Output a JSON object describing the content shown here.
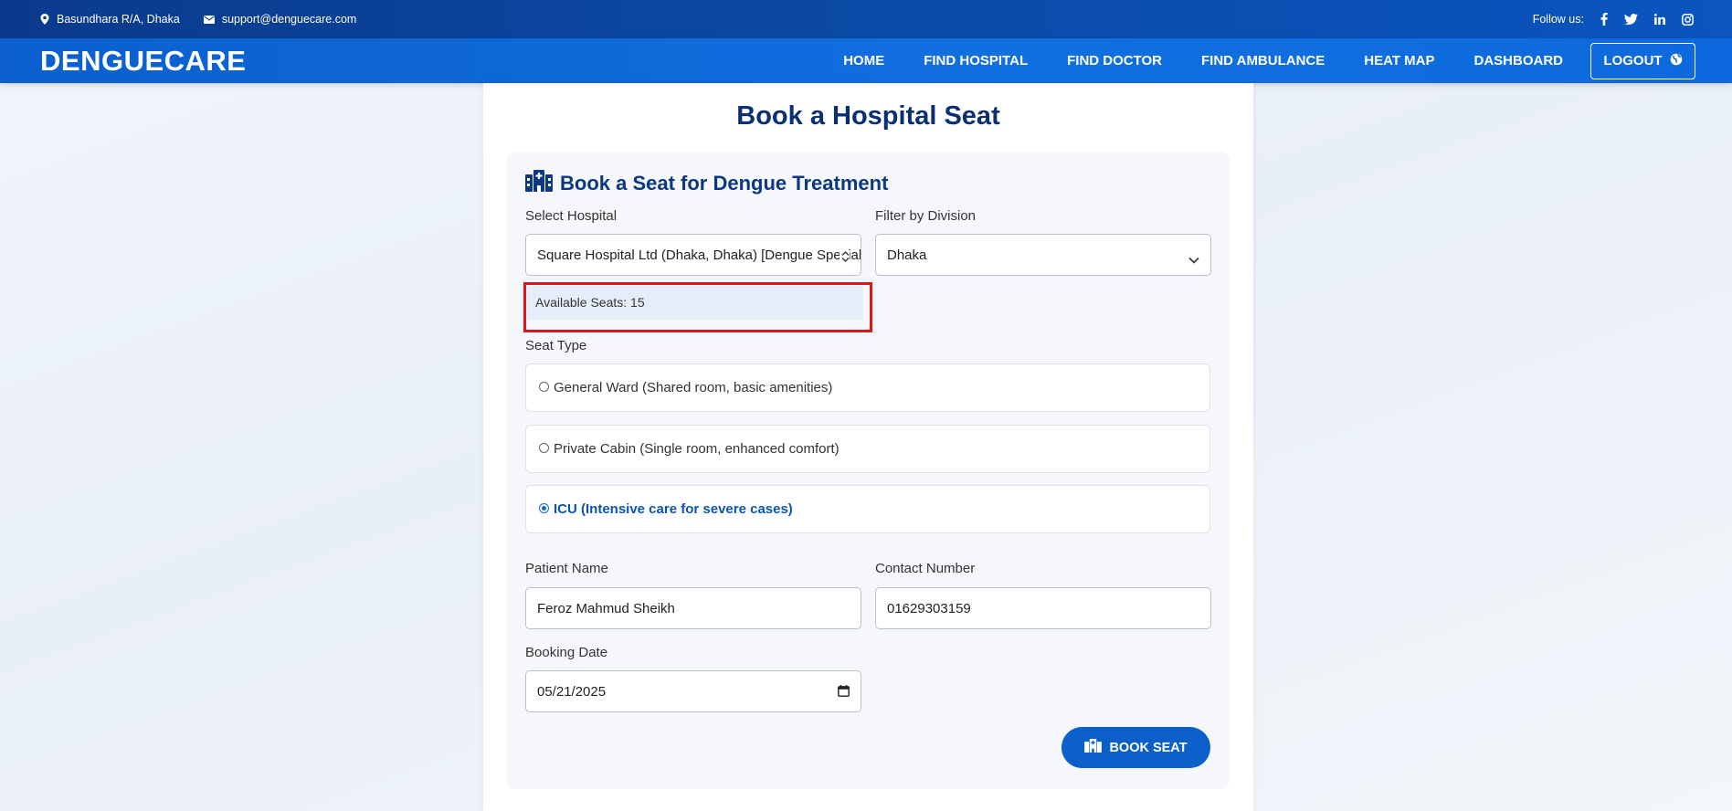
{
  "topbar": {
    "location": "Basundhara R/A, Dhaka",
    "email": "support@denguecare.com",
    "follow_label": "Follow us:",
    "social_icons": [
      "facebook-icon",
      "twitter-icon",
      "linkedin-icon",
      "instagram-icon"
    ]
  },
  "nav": {
    "brand": "DENGUECARE",
    "links": [
      "HOME",
      "FIND HOSPITAL",
      "FIND DOCTOR",
      "FIND AMBULANCE",
      "HEAT MAP",
      "DASHBOARD"
    ],
    "logout": "LOGOUT"
  },
  "page": {
    "title": "Book a Hospital Seat",
    "form_title": "Book a Seat for Dengue Treatment",
    "select_hospital_label": "Select Hospital",
    "selected_hospital": "Square Hospital Ltd (Dhaka, Dhaka) [Dengue Specialist]",
    "division_label": "Filter by Division",
    "selected_division": "Dhaka",
    "available_seats": "Available Seats: 15",
    "seat_type_label": "Seat Type",
    "seat_types": [
      {
        "label": "General Ward (Shared room, basic amenities)",
        "selected": false
      },
      {
        "label": "Private Cabin (Single room, enhanced comfort)",
        "selected": false
      },
      {
        "label": "ICU (Intensive care for severe cases)",
        "selected": true
      }
    ],
    "patient_name_label": "Patient Name",
    "patient_name": "Feroz Mahmud Sheikh",
    "contact_label": "Contact Number",
    "contact_number": "01629303159",
    "booking_date_label": "Booking Date",
    "booking_date": "05/21/2025",
    "book_button": "BOOK SEAT"
  },
  "colors": {
    "topbar": "#0a3a8c",
    "nav": "#0b5fcf",
    "heading": "#0b2f72",
    "highlight": "#e0161b",
    "accent": "#0b5fc9"
  }
}
